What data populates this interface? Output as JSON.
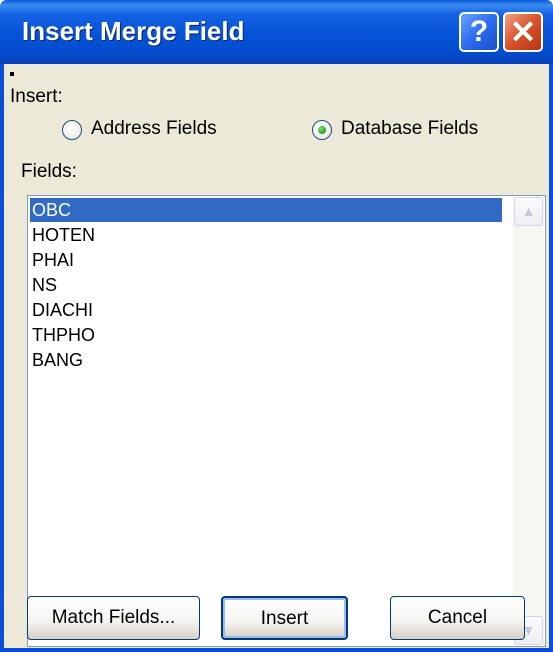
{
  "dialog": {
    "title": "Insert Merge Field"
  },
  "title_buttons": {
    "help": "?",
    "close": "✕"
  },
  "insert_label": "Insert:",
  "radios": [
    {
      "label": "Address Fields",
      "selected": false
    },
    {
      "label": "Database Fields",
      "selected": true
    }
  ],
  "fields_label": "Fields:",
  "fields": [
    "OBC",
    "HOTEN",
    "PHAI",
    "NS",
    "DIACHI",
    "THPHO",
    "BANG"
  ],
  "selected_field": "OBC",
  "scrollbar": {
    "up": "▲",
    "down": "▼"
  },
  "buttons": {
    "match_fields": "Match Fields...",
    "insert": "Insert",
    "cancel": "Cancel"
  },
  "colors": {
    "titlebar": "#0553d6",
    "client": "#ece9d8",
    "selection": "#316ac5"
  },
  "icons": {
    "help": "help-icon",
    "close": "close-icon"
  }
}
